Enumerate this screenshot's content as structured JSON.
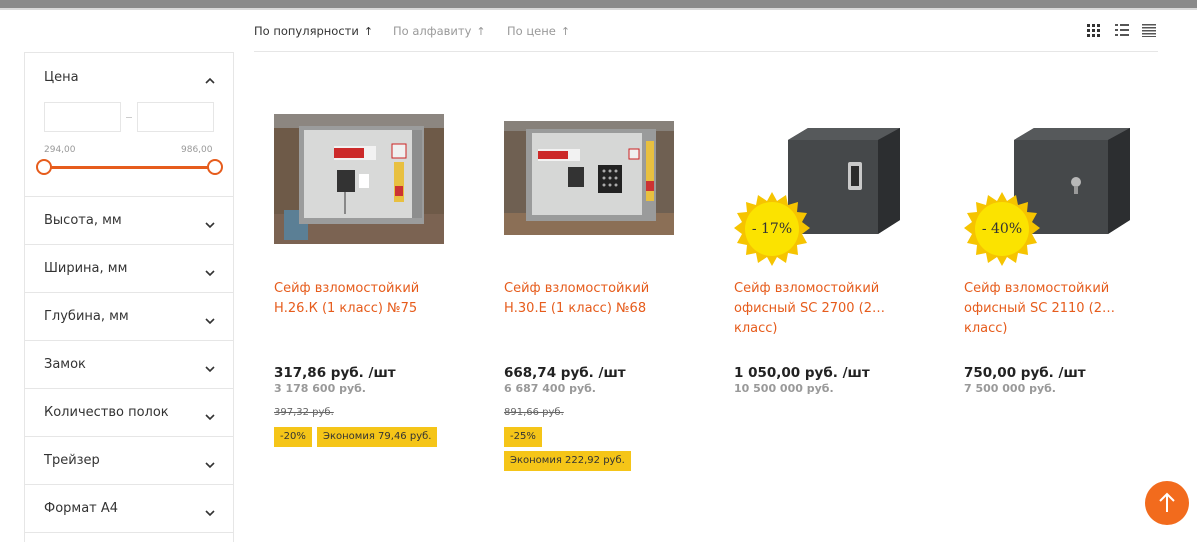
{
  "sort": {
    "items": [
      {
        "label": "По популярности",
        "arrow": "↑",
        "active": true
      },
      {
        "label": "По алфавиту",
        "arrow": "↑",
        "active": false
      },
      {
        "label": "По цене",
        "arrow": "↑",
        "active": false
      }
    ],
    "views": [
      "grid-view-icon",
      "list-view-icon",
      "table-view-icon"
    ]
  },
  "filters": {
    "price": {
      "title": "Цена",
      "min_value": "",
      "max_value": "",
      "range_min_label": "294,00",
      "range_max_label": "986,00"
    },
    "items": [
      {
        "label": "Высота, мм"
      },
      {
        "label": "Ширина, мм"
      },
      {
        "label": "Глубина, мм"
      },
      {
        "label": "Замок"
      },
      {
        "label": "Количество полок"
      },
      {
        "label": "Трейзер"
      },
      {
        "label": "Формат А4"
      }
    ]
  },
  "products": [
    {
      "title": "Сейф взломостойкий Н.26.К (1 класс) №75",
      "price": "317,86 руб. /шт",
      "alt_price": "3 178 600 руб.",
      "old_price": "397,32 руб.",
      "discount_badge": "-20%",
      "savings_badge": "Экономия 79,46 руб."
    },
    {
      "title": "Сейф взломостойкий Н.30.Е (1 класс) №68",
      "price": "668,74 руб. /шт",
      "alt_price": "6 687 400 руб.",
      "old_price": "891,66 руб.",
      "discount_badge": "-25%",
      "savings_badge": "Экономия 222,92 руб."
    },
    {
      "title": "Сейф взломостойкий офисный SC 2700 (2…",
      "title_line2": "класс)",
      "price": "1 050,00 руб. /шт",
      "alt_price": "10 500 000 руб.",
      "sale_label": "- 17%"
    },
    {
      "title": "Сейф взломостойкий офисный SC 2110 (2…",
      "title_line2": "класс)",
      "price": "750,00 руб. /шт",
      "alt_price": "7 500 000 руб.",
      "sale_label": "- 40%"
    }
  ],
  "colors": {
    "accent": "#e65c1c",
    "badge": "#f5c518",
    "up_button": "#f26b1d"
  }
}
